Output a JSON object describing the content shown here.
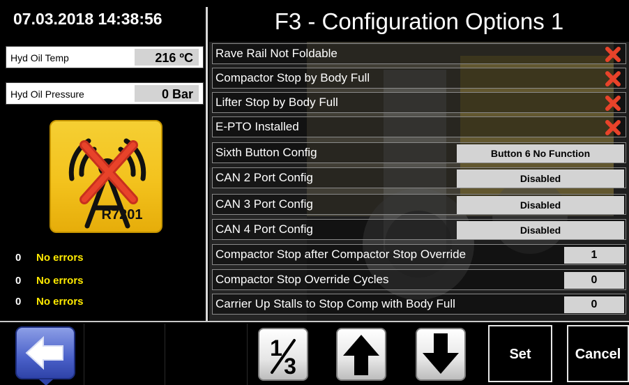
{
  "header": {
    "datetime": "07.03.2018  14:38:56",
    "title": "F3 - Configuration Options 1"
  },
  "sensors": [
    {
      "label": "Hyd Oil Temp",
      "value": "216 ºC"
    },
    {
      "label": "Hyd Oil Pressure",
      "value": "0 Bar"
    }
  ],
  "radio_tile": {
    "text": "R7201",
    "status": "disconnected"
  },
  "errors": [
    {
      "count": "0",
      "text": "No errors"
    },
    {
      "count": "0",
      "text": "No errors"
    },
    {
      "count": "0",
      "text": "No errors"
    }
  ],
  "options": [
    {
      "label": "Rave Rail Not Foldable",
      "type": "checkbox",
      "checked": false
    },
    {
      "label": "Compactor Stop by Body Full",
      "type": "checkbox",
      "checked": false
    },
    {
      "label": "Lifter Stop by Body Full",
      "type": "checkbox",
      "checked": false
    },
    {
      "label": "E-PTO Installed",
      "type": "checkbox",
      "checked": false
    },
    {
      "label": "Sixth Button Config",
      "type": "select",
      "value": "Button 6 No Function"
    },
    {
      "label": "CAN 2 Port Config",
      "type": "select",
      "value": "Disabled"
    },
    {
      "label": "CAN 3 Port Config",
      "type": "select",
      "value": "Disabled"
    },
    {
      "label": "CAN 4 Port Config",
      "type": "select",
      "value": "Disabled"
    },
    {
      "label": "Compactor Stop after Compactor Stop Override",
      "type": "number",
      "value": "1"
    },
    {
      "label": "Compactor Stop Override Cycles",
      "type": "number",
      "value": "0"
    },
    {
      "label": "Carrier Up Stalls to Stop  Comp with Body Full",
      "type": "number",
      "value": "0"
    }
  ],
  "footer": {
    "page_indicator": {
      "current": "1",
      "total": "3"
    },
    "set_label": "Set",
    "cancel_label": "Cancel"
  },
  "colors": {
    "accent_yellow": "#f3c21d",
    "error_text": "#ffea00",
    "x_mark": "#e8432a",
    "back_button": "#4a61c9"
  },
  "icons": [
    "radio-disconnected-icon",
    "back-arrow-icon",
    "up-arrow-icon",
    "down-arrow-icon",
    "x-mark-icon"
  ]
}
